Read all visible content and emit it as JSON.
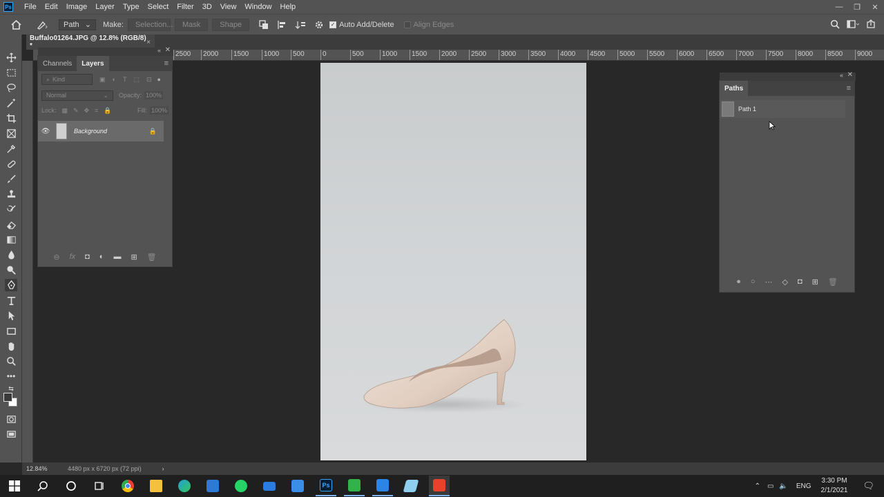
{
  "app": {
    "logo": "Ps",
    "accent": "#31a8ff"
  },
  "menu": [
    "File",
    "Edit",
    "Image",
    "Layer",
    "Type",
    "Select",
    "Filter",
    "3D",
    "View",
    "Window",
    "Help"
  ],
  "window_controls": [
    "minimize-icon",
    "restore-icon",
    "close-icon"
  ],
  "options": {
    "tool_mode": "Path",
    "make_label": "Make:",
    "selection_btn": "Selection...",
    "mask_btn": "Mask",
    "shape_btn": "Shape",
    "auto_add_delete": "Auto Add/Delete",
    "align_edges": "Align Edges"
  },
  "document": {
    "tab_title": "Buffalo01264.JPG @ 12.8% (RGB/8) *",
    "close": "×"
  },
  "ruler": {
    "ticks": [
      "2500",
      "2000",
      "1500",
      "1000",
      "500",
      "0",
      "500",
      "1000",
      "1500",
      "2000",
      "2500",
      "3000",
      "3500",
      "4000",
      "4500",
      "5000",
      "5500",
      "6000",
      "6500",
      "7000",
      "7500",
      "8000",
      "8500",
      "9000"
    ]
  },
  "layers_panel": {
    "tabs": [
      "Channels",
      "Layers"
    ],
    "active_tab": "Layers",
    "filter_placeholder": "Kind",
    "blend_mode": "Normal",
    "opacity_label": "Opacity:",
    "opacity_value": "100%",
    "lock_label": "Lock:",
    "fill_label": "Fill:",
    "fill_value": "100%",
    "layers": [
      {
        "name": "Background",
        "visible": true,
        "locked": true
      }
    ],
    "footer_icons": [
      "link-icon",
      "fx-icon",
      "mask-icon",
      "adjustment-icon",
      "folder-icon",
      "new-layer-icon",
      "trash-icon"
    ],
    "footer_glyphs": [
      "⊖",
      "fx",
      "◘",
      "◐",
      "▬",
      "⊞",
      "🗑"
    ]
  },
  "paths_panel": {
    "tab": "Paths",
    "paths": [
      {
        "name": "Path 1"
      }
    ],
    "footer_icons": [
      "fill-path-icon",
      "stroke-path-icon",
      "load-selection-icon",
      "make-path-icon",
      "add-mask-icon",
      "new-path-icon",
      "trash-icon"
    ],
    "footer_glyphs": [
      "●",
      "○",
      "⋯",
      "◇",
      "◘",
      "⊞",
      "🗑"
    ]
  },
  "status": {
    "zoom": "12.84%",
    "doc_info": "4480 px x 6720 px (72 ppi)",
    "arrow": "›"
  },
  "taskbar": {
    "apps": [
      {
        "name": "chrome",
        "color": "#e94235"
      },
      {
        "name": "file-explorer",
        "color": "#f4c03e"
      },
      {
        "name": "edge",
        "color": "#1fa0d8"
      },
      {
        "name": "store",
        "color": "#2d7ad6"
      },
      {
        "name": "whatsapp",
        "color": "#25d366"
      },
      {
        "name": "mail",
        "color": "#2a7ce0"
      },
      {
        "name": "app-blue",
        "color": "#3a8ee8"
      },
      {
        "name": "photoshop",
        "color": "#001e36"
      },
      {
        "name": "camtasia-green",
        "color": "#32b24a"
      },
      {
        "name": "photos",
        "color": "#2c84e4"
      },
      {
        "name": "app-crystal",
        "color": "#8fd0f0"
      },
      {
        "name": "camtasia-red",
        "color": "#e8412c"
      }
    ],
    "ps_label": "Ps",
    "language": "ENG",
    "time": "3:30 PM",
    "date": "2/1/2021"
  }
}
